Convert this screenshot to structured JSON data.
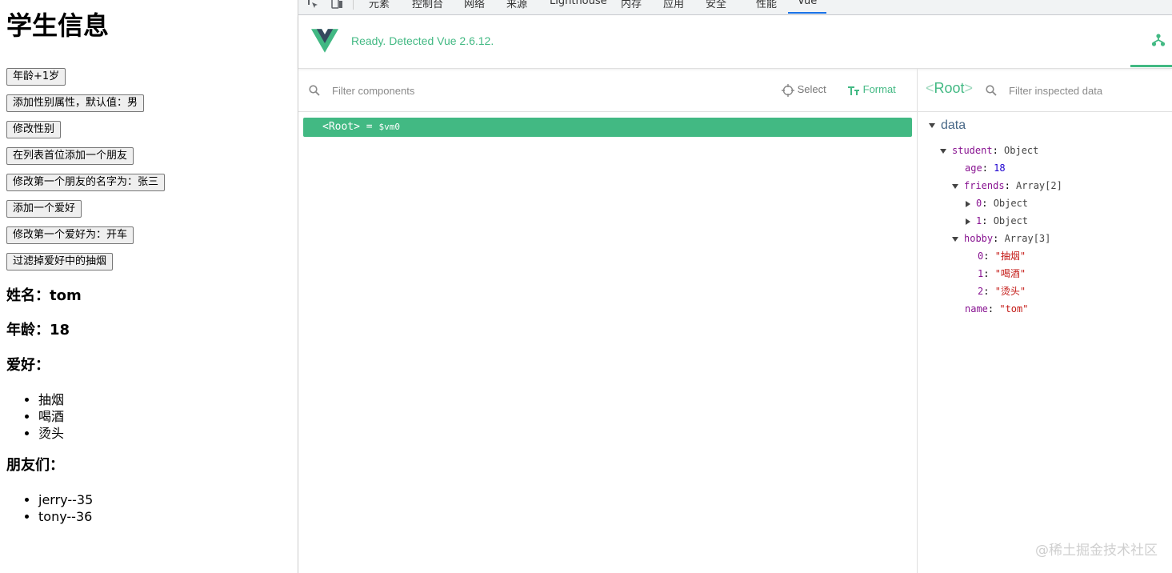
{
  "page": {
    "title": "学生信息",
    "buttons": [
      "年龄+1岁",
      "添加性别属性，默认值：男",
      "修改性别",
      "在列表首位添加一个朋友",
      "修改第一个朋友的名字为：张三",
      "添加一个爱好",
      "修改第一个爱好为：开车",
      "过滤掉爱好中的抽烟"
    ],
    "name_line": "姓名：tom",
    "age_line": "年龄：18",
    "hobby_heading": "爱好：",
    "hobbies": [
      "抽烟",
      "喝酒",
      "烫头"
    ],
    "friends_heading": "朋友们：",
    "friends": [
      "jerry--35",
      "tony--36"
    ]
  },
  "devtools": {
    "tabs": [
      "元素",
      "控制台",
      "网络",
      "来源",
      "Lighthouse",
      "内存",
      "应用",
      "安全",
      "性能",
      "Vue"
    ],
    "active_tab": "Vue",
    "ready_text": "Ready. Detected Vue 2.6.12.",
    "filter_components_placeholder": "Filter components",
    "select_label": "Select",
    "format_label": "Format",
    "root_row_name": "<Root>",
    "root_row_eq": " = ",
    "root_row_vm": "$vm0",
    "inspected_title": "Root",
    "filter_inspected_placeholder": "Filter inspected data",
    "data_section": "data",
    "state": {
      "student_key": "student",
      "student_type": "Object",
      "age_key": "age",
      "age_val": "18",
      "friends_key": "friends",
      "friends_type": "Array[2]",
      "friend0_key": "0",
      "friend0_type": "Object",
      "friend1_key": "1",
      "friend1_type": "Object",
      "hobby_key": "hobby",
      "hobby_type": "Array[3]",
      "hobby_items": [
        {
          "k": "0",
          "v": "\"抽烟\""
        },
        {
          "k": "1",
          "v": "\"喝酒\""
        },
        {
          "k": "2",
          "v": "\"烫头\""
        }
      ],
      "name_key": "name",
      "name_val": "\"tom\""
    }
  },
  "watermark": "@稀土掘金技术社区",
  "colors": {
    "vue_green": "#42b983",
    "active_tab_blue": "#1a73e8"
  }
}
